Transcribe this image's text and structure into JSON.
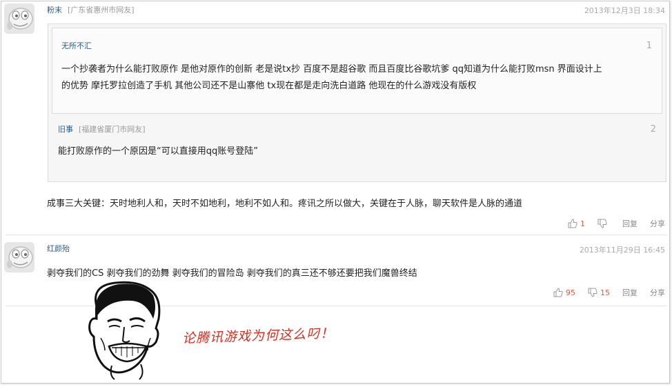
{
  "comments": [
    {
      "user": "粉末",
      "location": "[广东省惠州市网友]",
      "time": "2013年12月3日 18:34",
      "quotes": [
        {
          "user": "无所不汇",
          "index": "1",
          "text_line1": "一个抄袭者为什么能打败原作  是他对原作的创新  老是说tx抄  百度不是超谷歌  而且百度比谷歌坑爹  qq知道为什么能打败msn 界面设计上",
          "text_line2": "的优势  摩托罗拉创造了手机  其他公司还不是山寨他  tx现在都是走向洗白道路  他现在的什么游戏没有版权"
        },
        {
          "user": "旧事",
          "location": "[福建省厦门市网友]",
          "index": "2",
          "text": "能打败原作的一个原因是“可以直接用qq账号登陆”"
        }
      ],
      "text": "成事三大关键：天时地利人和，天时不如地利，地利不如人和。疼讯之所以做大，关键在于人脉，聊天软件是人脉的通道",
      "likes": "1",
      "dislikes": "",
      "reply_label": "回复",
      "share_label": "分享"
    },
    {
      "user": "红颜殆",
      "location": "",
      "time": "2013年11月29日 16:45",
      "text": "剥夺我们的CS 剥夺我们的劲舞 剥夺我们的冒险岛 剥夺我们的真三还不够还要把我们魔兽终结",
      "likes": "95",
      "dislikes": "15",
      "reply_label": "回复",
      "share_label": "分享",
      "meme_caption": "论腾讯游戏为何这么叼！"
    }
  ],
  "colors": {
    "username": "#2a5c8a",
    "count": "#e4573d",
    "caption": "#e32a1c"
  }
}
